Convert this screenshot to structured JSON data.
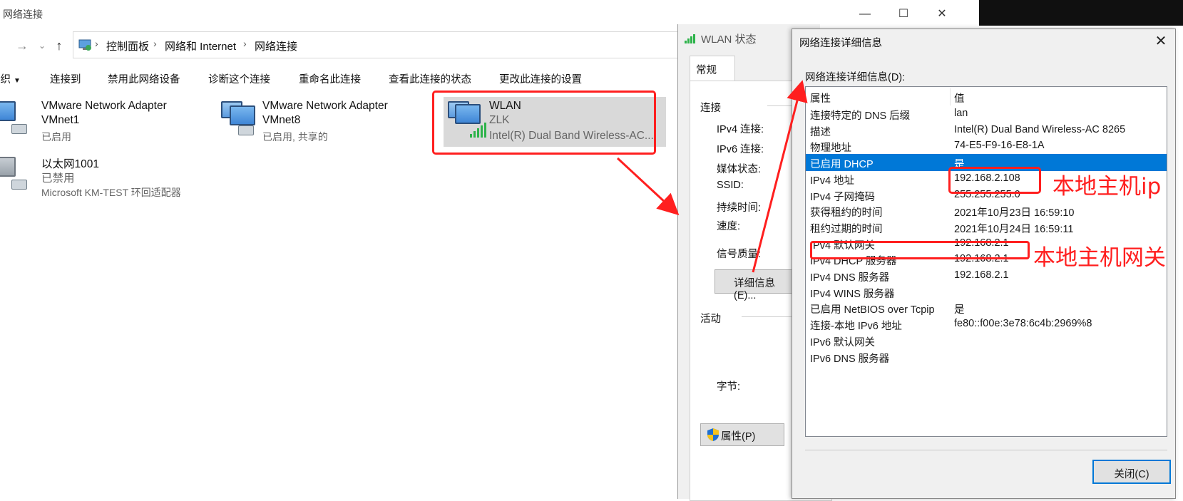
{
  "explorer": {
    "title": "网络连接",
    "breadcrumb": [
      "控制面板",
      "网络和 Internet",
      "网络连接"
    ],
    "toolbar": [
      "组织",
      "连接到",
      "禁用此网络设备",
      "诊断这个连接",
      "重命名此连接",
      "查看此连接的状态",
      "更改此连接的设置"
    ],
    "adapters": [
      {
        "line1": "VMware Network Adapter",
        "line2": "VMnet1",
        "line3": "已启用"
      },
      {
        "line1": "VMware Network Adapter",
        "line2": "VMnet8",
        "line3": "已启用, 共享的"
      },
      {
        "line1": "WLAN",
        "line2": "ZLK",
        "line3": "Intel(R) Dual Band Wireless-AC..."
      },
      {
        "line1": "以太网1001",
        "line2": "已禁用",
        "line3": "Microsoft KM-TEST 环回适配器"
      }
    ]
  },
  "wlan_status": {
    "title": "WLAN 状态",
    "tab": "常规",
    "section_connection": "连接",
    "fields": [
      "IPv4 连接:",
      "IPv6 连接:",
      "媒体状态:",
      "SSID:",
      "持续时间:",
      "速度:",
      "信号质量:"
    ],
    "details_button": "详细信息(E)...",
    "section_activity": "活动",
    "bytes_label": "字节:",
    "properties_button": "属性(P)"
  },
  "details_dialog": {
    "title": "网络连接详细信息",
    "list_label": "网络连接详细信息(D):",
    "col_property": "属性",
    "col_value": "值",
    "rows": [
      {
        "p": "连接特定的 DNS 后缀",
        "v": "lan"
      },
      {
        "p": "描述",
        "v": "Intel(R) Dual Band Wireless-AC 8265"
      },
      {
        "p": "物理地址",
        "v": "74-E5-F9-16-E8-1A"
      },
      {
        "p": "已启用 DHCP",
        "v": "是"
      },
      {
        "p": "IPv4 地址",
        "v": "192.168.2.108"
      },
      {
        "p": "IPv4 子网掩码",
        "v": "255.255.255.0"
      },
      {
        "p": "获得租约的时间",
        "v": "2021年10月23日 16:59:10"
      },
      {
        "p": "租约过期的时间",
        "v": "2021年10月24日 16:59:11"
      },
      {
        "p": "IPv4 默认网关",
        "v": "192.168.2.1"
      },
      {
        "p": "IPv4 DHCP 服务器",
        "v": "192.168.2.1"
      },
      {
        "p": "IPv4 DNS 服务器",
        "v": "192.168.2.1"
      },
      {
        "p": "IPv4 WINS 服务器",
        "v": ""
      },
      {
        "p": "已启用 NetBIOS over Tcpip",
        "v": "是"
      },
      {
        "p": "连接-本地 IPv6 地址",
        "v": "fe80::f00e:3e78:6c4b:2969%8"
      },
      {
        "p": "IPv6 默认网关",
        "v": ""
      },
      {
        "p": "IPv6 DNS 服务器",
        "v": ""
      }
    ],
    "close_button": "关闭(C)"
  },
  "annotations": {
    "local_ip": "本地主机ip",
    "local_gateway": "本地主机网关"
  },
  "colors": {
    "accent": "#0078d7",
    "annotation": "#ff1f1f",
    "signal": "#2db34a"
  }
}
